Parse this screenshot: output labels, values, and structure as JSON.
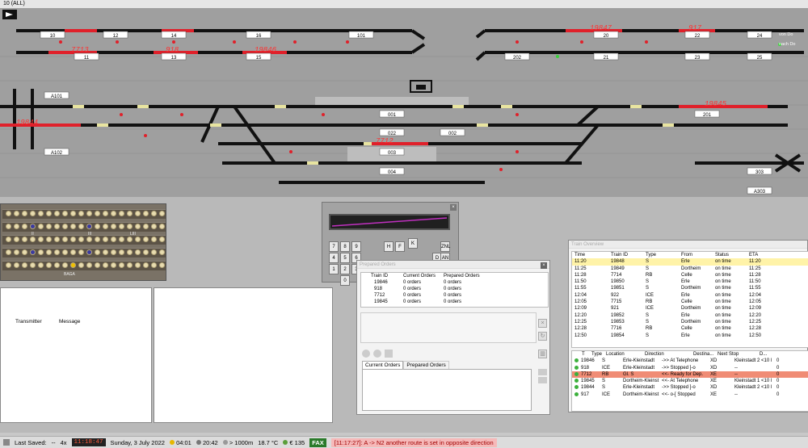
{
  "window": {
    "title": "10 (ALL)"
  },
  "track": {
    "block_labels_top": [
      "10",
      "12",
      "14",
      "16",
      "101",
      "20",
      "22",
      "24"
    ],
    "block_labels_row2": [
      "11",
      "13",
      "15",
      "202",
      "21",
      "23",
      "25"
    ],
    "block_labels_mid": [
      "A101",
      "001",
      "201",
      "A102",
      "002",
      "022",
      "003",
      "004",
      "303",
      "A303"
    ],
    "train_numbers": [
      "7713",
      "918",
      "19846",
      "19847",
      "917",
      "19845",
      "19844",
      "7712"
    ],
    "signs": [
      "von Do",
      "nach Do"
    ]
  },
  "receiver": {
    "labels": [
      "II",
      "III",
      "LIII",
      "BAGA"
    ]
  },
  "keypad": {
    "keys": [
      "7",
      "8",
      "9",
      "4",
      "5",
      "6",
      "1",
      "2",
      "3",
      "0",
      "H",
      "F",
      "K",
      "ZNL",
      "D",
      "AN"
    ]
  },
  "message_log": {
    "col_transmitter": "Transmitter",
    "col_message": "Message"
  },
  "prepared_orders": {
    "title": "Prepared Orders",
    "headers": [
      "Train ID",
      "Current Orders",
      "Prepared Orders"
    ],
    "rows": [
      [
        "19846",
        "0 orders",
        "0 orders"
      ],
      [
        "918",
        "0 orders",
        "0 orders"
      ],
      [
        "7712",
        "0 orders",
        "0 orders"
      ],
      [
        "19845",
        "0 orders",
        "0 orders"
      ]
    ],
    "tabs": [
      "Current Orders",
      "Prepared Orders"
    ]
  },
  "train_overview": {
    "title": "Train Overview",
    "headers": [
      "Time",
      "Train ID",
      "Type",
      "From",
      "Status",
      "ETA"
    ],
    "rows": [
      [
        "11:20",
        "19848",
        "S",
        "Erle",
        "on time",
        "11:20"
      ],
      [
        "11:25",
        "19849",
        "S",
        "Dortheim",
        "on time",
        "11:25"
      ],
      [
        "11:28",
        "7714",
        "RB",
        "Celle",
        "on time",
        "11:28"
      ],
      [
        "11:50",
        "19850",
        "S",
        "Erle",
        "on time",
        "11:50"
      ],
      [
        "11:55",
        "19851",
        "S",
        "Dortheim",
        "on time",
        "11:55"
      ],
      [
        "12:04",
        "922",
        "ICE",
        "Erle",
        "on time",
        "12:04"
      ],
      [
        "12:05",
        "7715",
        "RB",
        "Celle",
        "on time",
        "12:05"
      ],
      [
        "12:09",
        "921",
        "ICE",
        "Dortheim",
        "on time",
        "12:09"
      ],
      [
        "12:20",
        "19852",
        "S",
        "Erle",
        "on time",
        "12:20"
      ],
      [
        "12:25",
        "19853",
        "S",
        "Dortheim",
        "on time",
        "12:25"
      ],
      [
        "12:28",
        "7716",
        "RB",
        "Celle",
        "on time",
        "12:28"
      ],
      [
        "12:50",
        "19854",
        "S",
        "Erle",
        "on time",
        "12:50"
      ]
    ],
    "active_headers": [
      "Trai...",
      "Type",
      "Location",
      "Direction",
      "Destina...",
      "Next Stop",
      "D..."
    ],
    "active_rows": [
      [
        "19846",
        "S",
        "Erle-Kleinstadt",
        "->> At Telephone",
        "XD",
        "Kleinstadt 2 <10 l",
        "0"
      ],
      [
        "918",
        "ICE",
        "Erle-Kleinstadt",
        "->> Stopped ]-o",
        "XD",
        "--",
        "0"
      ],
      [
        "7712",
        "RB",
        "Gl. S",
        "<<- Ready for Dep.",
        "XE",
        "--",
        "0"
      ],
      [
        "19845",
        "S",
        "Dortheim-Kleinst",
        "<<- At Telephone",
        "XE",
        "Kleinstadt 1 <10 l",
        "0"
      ],
      [
        "19844",
        "S",
        "Erle-Kleinstadt",
        "->> Stopped ]-o",
        "XD",
        "Kleinstadt 2 <10 l",
        "0"
      ],
      [
        "917",
        "ICE",
        "Dortheim-Kleinst",
        "<<- o-[ Stopped",
        "XE",
        "--",
        "0"
      ]
    ]
  },
  "status_bar": {
    "last_saved_label": "Last Saved:",
    "last_saved_value": "--",
    "speed": "4x",
    "clock": "11:18:47",
    "date": "Sunday, 3 July 2022",
    "sunrise": "04:01",
    "sunset": "20:42",
    "visibility": "> 1000m",
    "temperature": "18.7 °C",
    "money": "€ 135",
    "fax": "FAX",
    "alert": "[11:17:27]: A -> N2 another route is set in opposite direction"
  },
  "colors": {
    "track_bg": "#9f9f9f",
    "signal_red": "#e0202a",
    "alert": "#f6b9b9",
    "highlight": "#fff3a8",
    "selected": "#f08c75"
  }
}
